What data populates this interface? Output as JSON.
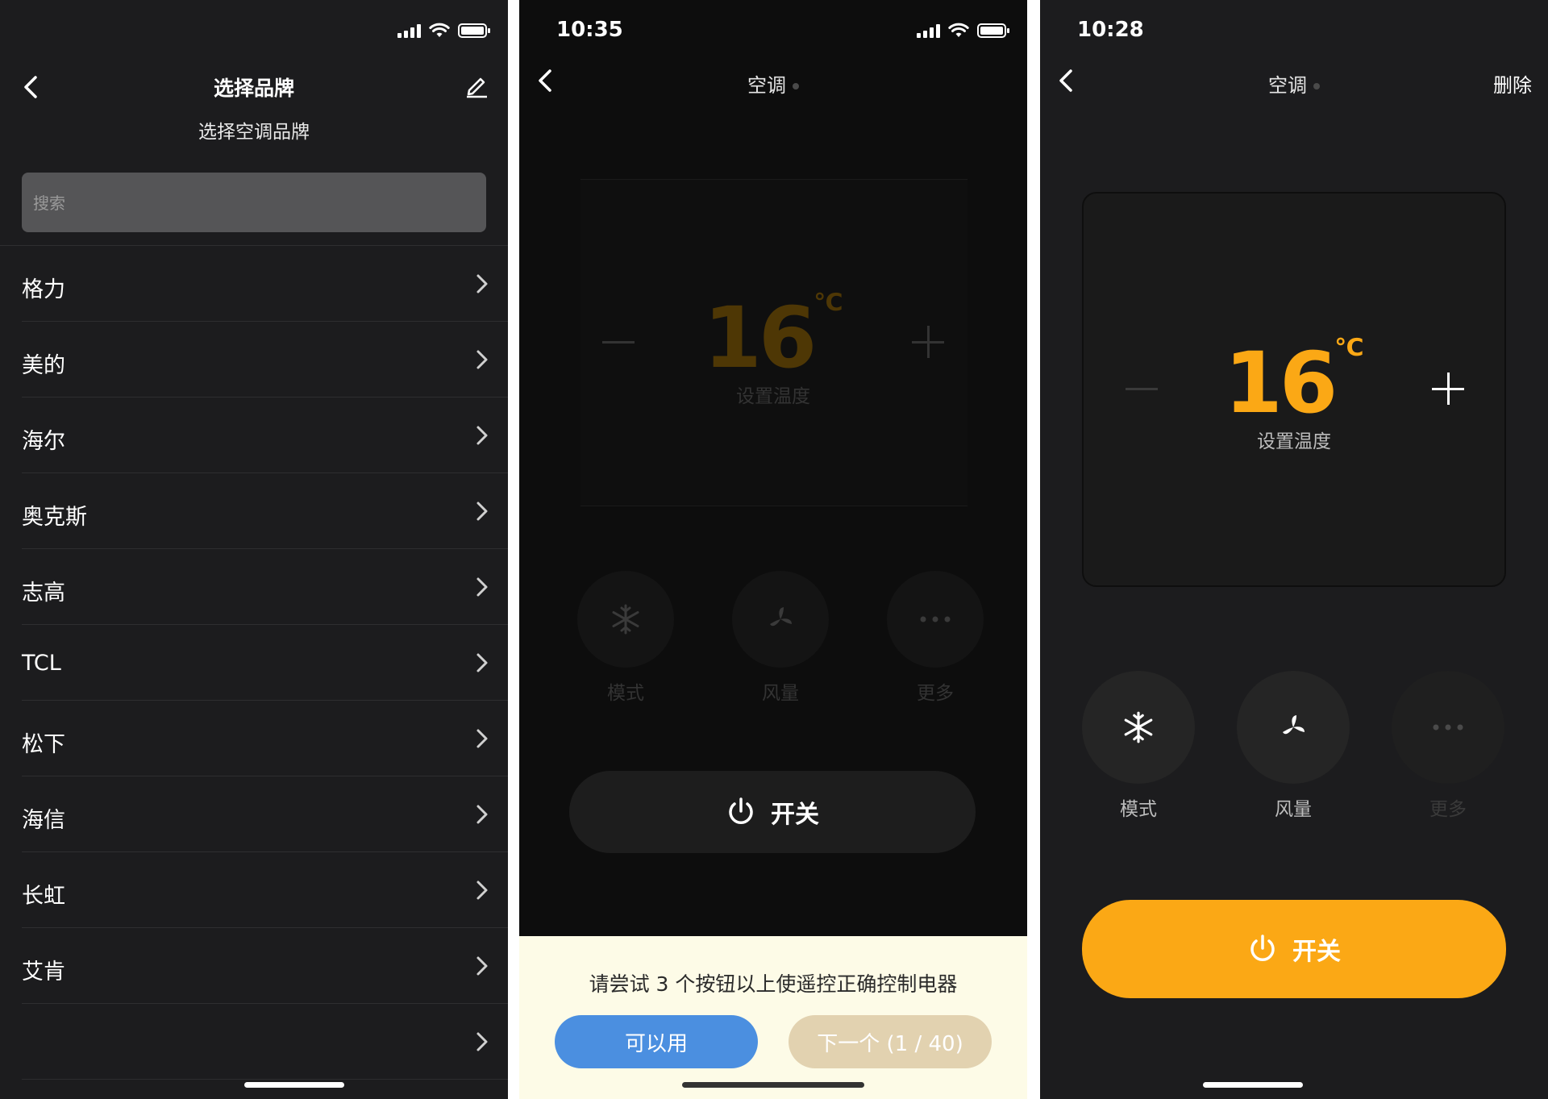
{
  "brand_screen": {
    "title": "选择品牌",
    "subtitle": "选择空调品牌",
    "search_placeholder": "搜索",
    "brands": [
      "格力",
      "美的",
      "海尔",
      "奥克斯",
      "志高",
      "TCL",
      "松下",
      "海信",
      "长虹",
      "艾肯"
    ]
  },
  "test_screen": {
    "time": "10:35",
    "title": "空调",
    "temperature": "16",
    "unit": "℃",
    "temp_label": "设置温度",
    "mode_label": "模式",
    "fan_label": "风量",
    "more_label": "更多",
    "power_label": "开关",
    "prompt_text": "请尝试 3 个按钮以上使遥控正确控制电器",
    "ok_button": "可以用",
    "next_button": "下一个 (1 / 40)"
  },
  "remote_screen": {
    "time": "10:28",
    "title": "空调",
    "delete_label": "删除",
    "temperature": "16",
    "unit": "℃",
    "temp_label": "设置温度",
    "mode_label": "模式",
    "fan_label": "风量",
    "more_label": "更多",
    "power_label": "开关"
  },
  "colors": {
    "accent_orange": "#fba815",
    "button_blue": "#4b8fe0",
    "prompt_bg": "#fdfbe7"
  },
  "icons": [
    "signal-icon",
    "wifi-icon",
    "battery-icon",
    "back-icon",
    "edit-icon",
    "chevron-right-icon",
    "snowflake-icon",
    "fan-icon",
    "more-icon",
    "power-icon",
    "minus-icon",
    "plus-icon"
  ]
}
